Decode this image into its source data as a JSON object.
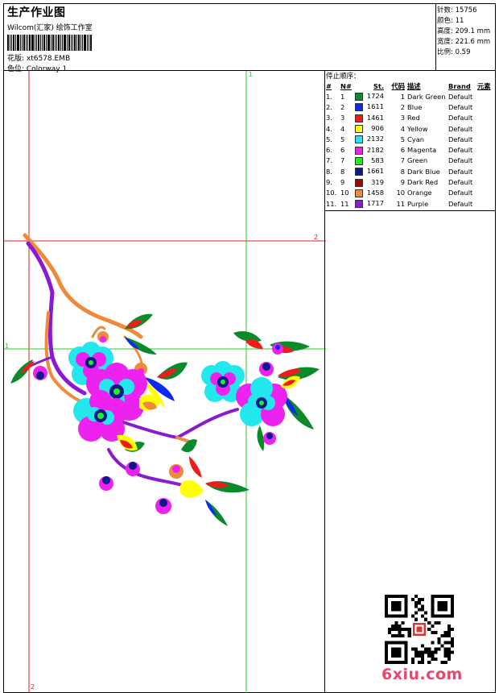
{
  "header": {
    "title": "生产作业图",
    "company": "Wilcom(汇家) 绘饰工作室",
    "pattern": "花版: xt6578.EMB",
    "colorway": "色位:  Colorway 1"
  },
  "specs": [
    "针数: 15756",
    "颜色: 11",
    "高度: 209.1 mm",
    "宽度: 221.6 mm",
    "比例: 0.59"
  ],
  "legend": {
    "title": "停止顺序：",
    "headers": [
      "#",
      "N#",
      "St.",
      "代码",
      "描述",
      "Brand",
      "元素"
    ],
    "rows": [
      {
        "idx": "1.",
        "n": "1",
        "color": "#0a8a2a",
        "st": "1724",
        "code": "1",
        "desc": "Dark Green",
        "brand": "Default"
      },
      {
        "idx": "2.",
        "n": "2",
        "color": "#0a2af0",
        "st": "1611",
        "code": "2",
        "desc": "Blue",
        "brand": "Default"
      },
      {
        "idx": "3.",
        "n": "3",
        "color": "#ee1c1c",
        "st": "1461",
        "code": "3",
        "desc": "Red",
        "brand": "Default"
      },
      {
        "idx": "4.",
        "n": "4",
        "color": "#ffff00",
        "st": "906",
        "code": "4",
        "desc": "Yellow",
        "brand": "Default"
      },
      {
        "idx": "5.",
        "n": "5",
        "color": "#22e8ee",
        "st": "2132",
        "code": "5",
        "desc": "Cyan",
        "brand": "Default"
      },
      {
        "idx": "6.",
        "n": "6",
        "color": "#ee22ee",
        "st": "2182",
        "code": "6",
        "desc": "Magenta",
        "brand": "Default"
      },
      {
        "idx": "7.",
        "n": "7",
        "color": "#22ee22",
        "st": "583",
        "code": "7",
        "desc": "Green",
        "brand": "Default"
      },
      {
        "idx": "8.",
        "n": "8",
        "color": "#0a1a8a",
        "st": "1661",
        "code": "8",
        "desc": "Dark Blue",
        "brand": "Default"
      },
      {
        "idx": "9.",
        "n": "9",
        "color": "#9a0a0a",
        "st": "319",
        "code": "9",
        "desc": "Dark Red",
        "brand": "Default"
      },
      {
        "idx": "10.",
        "n": "10",
        "color": "#f08a3a",
        "st": "1458",
        "code": "10",
        "desc": "Orange",
        "brand": "Default"
      },
      {
        "idx": "11.",
        "n": "11",
        "color": "#8a1ad0",
        "st": "1717",
        "code": "11",
        "desc": "Purple",
        "brand": "Default"
      }
    ]
  },
  "guides": {
    "v1": "1",
    "v2": "2",
    "h1": "1",
    "h2": "2"
  },
  "watermark": "6xiu.com",
  "colors": {
    "guide_red": "#e02020",
    "guide_green": "#20d020"
  }
}
